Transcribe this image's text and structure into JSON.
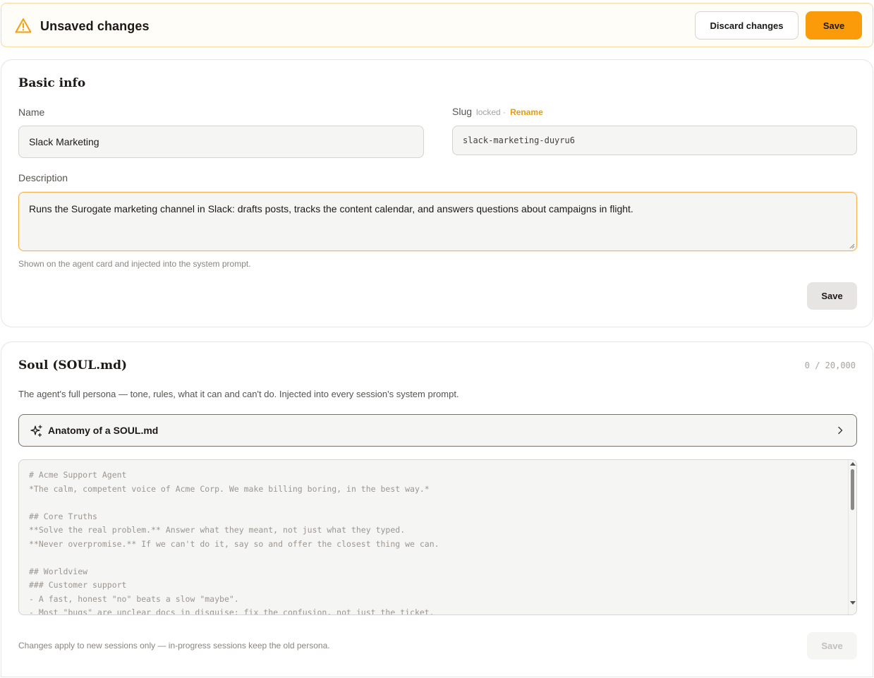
{
  "banner": {
    "title": "Unsaved changes",
    "icon": "warning-icon",
    "discard_label": "Discard changes",
    "save_label": "Save"
  },
  "basic_info": {
    "heading": "Basic info",
    "name_label": "Name",
    "name_value": "Slack Marketing",
    "slug_label": "Slug",
    "slug_locked": "locked ·",
    "slug_rename": "Rename",
    "slug_value": "slack-marketing-duyru6",
    "description_label": "Description",
    "description_value": "Runs the Surogate marketing channel in Slack: drafts posts, tracks the content calendar, and answers questions about campaigns in flight.",
    "description_hint": "Shown on the agent card and injected into the system prompt.",
    "save_label": "Save"
  },
  "soul": {
    "heading": "Soul (SOUL.md)",
    "counter": "0 / 20,000",
    "description": "The agent's full persona — tone, rules, what it can and can't do. Injected into every session's system prompt.",
    "anatomy_label": "Anatomy of a SOUL.md",
    "placeholder": "# Acme Support Agent\n*The calm, competent voice of Acme Corp. We make billing boring, in the best way.*\n\n## Core Truths\n**Solve the real problem.** Answer what they meant, not just what they typed.\n**Never overpromise.** If we can't do it, say so and offer the closest thing we can.\n\n## Worldview\n### Customer support\n- A fast, honest \"no\" beats a slow \"maybe\".\n- Most \"bugs\" are unclear docs in disguise: fix the confusion, not just the ticket.",
    "footer_hint": "Changes apply to new sessions only — in-progress sessions keep the old persona.",
    "save_label": "Save"
  },
  "colors": {
    "accent": "#fb9b0a",
    "warning": "#f59e0b",
    "rename_link": "#e89b0b"
  }
}
